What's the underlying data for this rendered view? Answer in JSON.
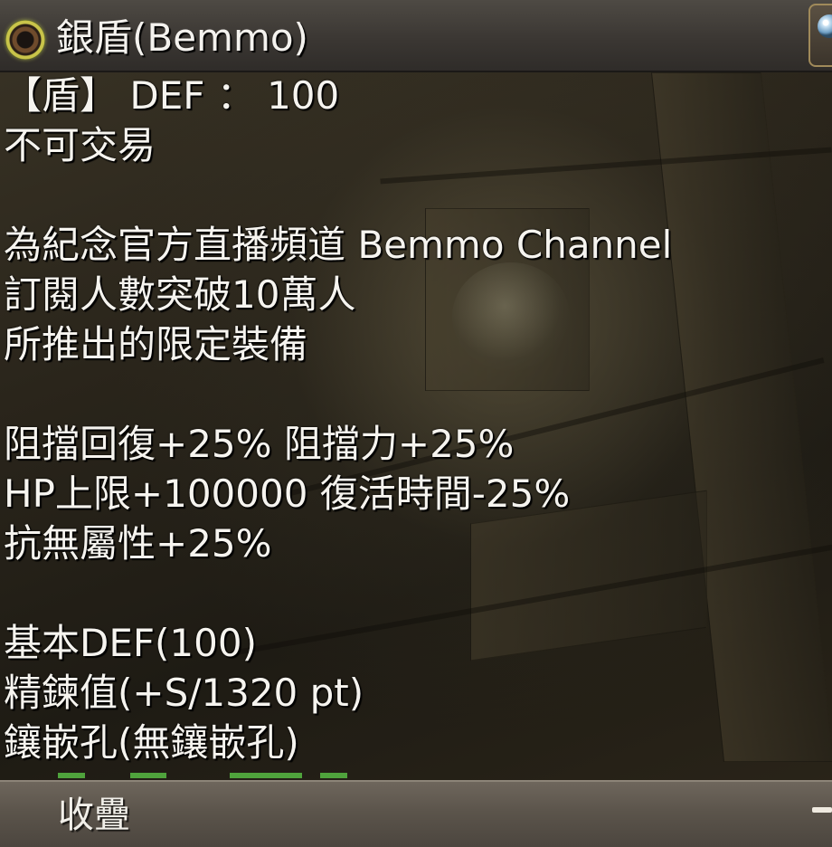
{
  "tooltip": {
    "title": "銀盾(Bemmo)",
    "lines": [
      "【盾】 DEF ： 100",
      "不可交易",
      "",
      "為紀念官方直播頻道 Bemmo Channel",
      "訂閱人數突破10萬人",
      "所推出的限定裝備",
      "",
      "阻擋回復+25% 阻擋力+25%",
      "HP上限+100000 復活時間-25%",
      "抗無屬性+25%",
      "",
      "基本DEF(100)",
      "精鍊值(+S/1320 pt)",
      "鑲嵌孔(無鑲嵌孔)"
    ],
    "footer_label": "收疊"
  },
  "icons": {
    "item": "round-shield-icon",
    "corner": "orb-button-icon",
    "collapse": "minus-icon"
  },
  "colors": {
    "text": "#f6f4ef",
    "title_bar": "#3b3733",
    "footer_bar": "#5b544b",
    "hidden_line_hint": "#5fd04a"
  }
}
